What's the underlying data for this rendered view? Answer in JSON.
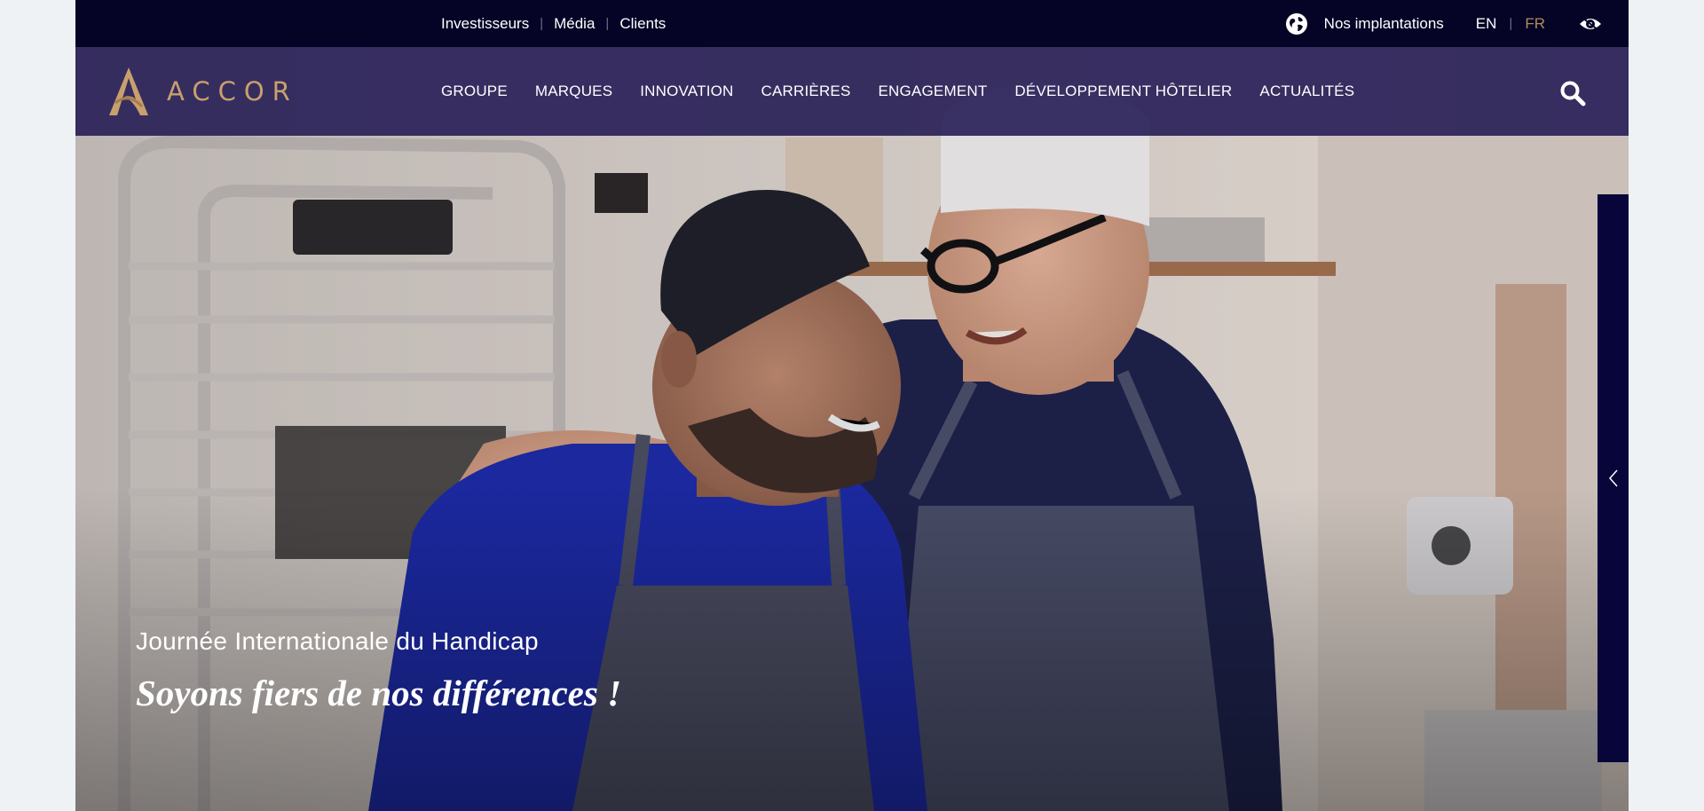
{
  "topbar": {
    "links": [
      "Investisseurs",
      "Média",
      "Clients"
    ],
    "locations_label": "Nos implantations",
    "lang_en": "EN",
    "lang_fr": "FR",
    "globe_icon": "globe-icon",
    "accessibility_icon": "eye-icon"
  },
  "brand": {
    "logo_text": "ACCOR",
    "gold": "#c9a06d"
  },
  "nav": {
    "items": [
      "GROUPE",
      "MARQUES",
      "INNOVATION",
      "CARRIÈRES",
      "ENGAGEMENT",
      "DÉVELOPPEMENT HÔTELIER",
      "ACTUALITÉS"
    ],
    "search_icon": "search-icon"
  },
  "hero": {
    "kicker": "Journée Internationale du Handicap",
    "title": "Soyons fiers de nos différences !"
  },
  "slider": {
    "prev_icon": "chevron-left-icon"
  },
  "colors": {
    "topbar_bg": "#050426",
    "nav_bg": "#2a2158",
    "active_lang": "#b28a5b"
  }
}
